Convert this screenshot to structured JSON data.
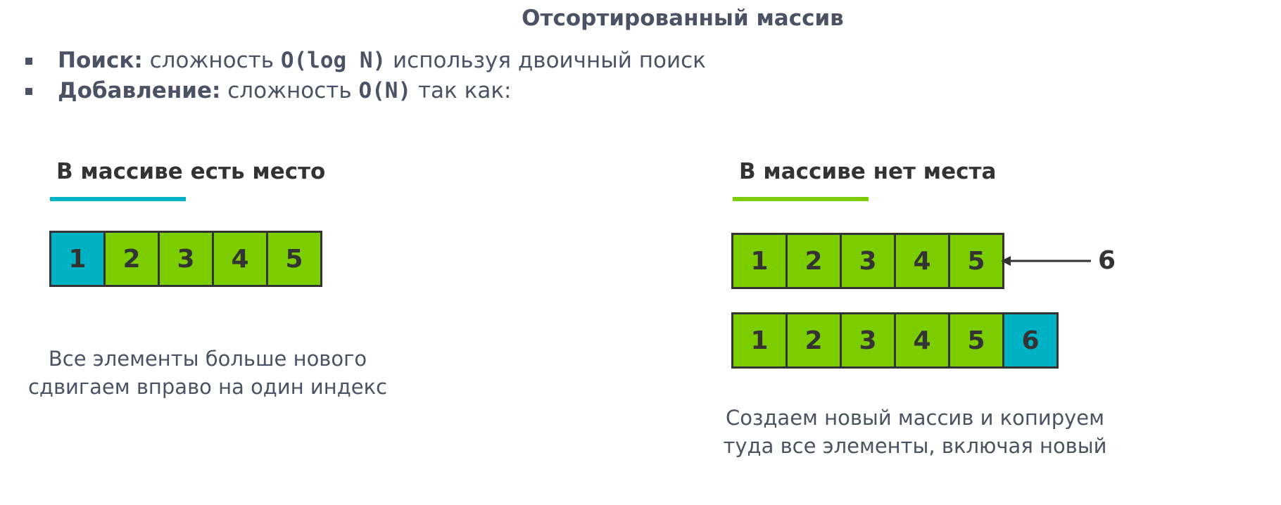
{
  "title": "Отсортированный массив",
  "bullets": [
    {
      "bold": "Поиск:",
      "pre": " сложность ",
      "code": "O(log N)",
      "post": " используя двоичный поиск"
    },
    {
      "bold": "Добавление:",
      "pre": " сложность ",
      "code": "O(N)",
      "post": " так как:"
    }
  ],
  "left": {
    "heading": "В массиве есть место",
    "array": [
      "1",
      "2",
      "3",
      "4",
      "5"
    ],
    "caption": [
      "Все элементы больше нового",
      "сдвигаем вправо на один индекс"
    ]
  },
  "right": {
    "heading": "В массиве нет места",
    "array_old": [
      "1",
      "2",
      "3",
      "4",
      "5"
    ],
    "incoming": "6",
    "array_new": [
      "1",
      "2",
      "3",
      "4",
      "5",
      "6"
    ],
    "caption": [
      "Создаем новый массив и копируем",
      "туда все элементы, включая новый"
    ]
  },
  "colors": {
    "green": "#7ccd00",
    "teal": "#00b2c3",
    "text": "#4a5263",
    "border": "#333333"
  }
}
